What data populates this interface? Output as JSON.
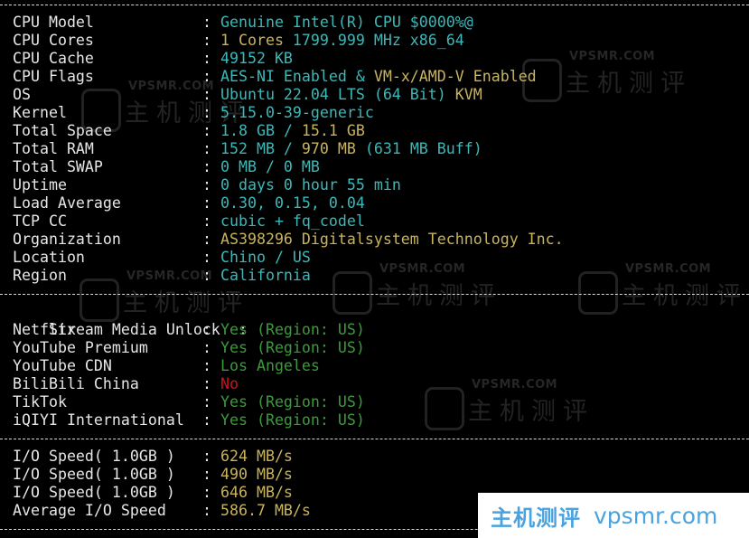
{
  "system_info": [
    {
      "label": "CPU Model",
      "segments": [
        {
          "text": "Genuine Intel(R) CPU $0000%@",
          "color": "cyan"
        }
      ]
    },
    {
      "label": "CPU Cores",
      "segments": [
        {
          "text": "1 Cores",
          "color": "yellow"
        },
        {
          "text": " 1799.999 MHz x86_64",
          "color": "cyan"
        }
      ]
    },
    {
      "label": "CPU Cache",
      "segments": [
        {
          "text": "49152 KB",
          "color": "cyan"
        }
      ]
    },
    {
      "label": "CPU Flags",
      "segments": [
        {
          "text": "AES-NI Enabled & ",
          "color": "cyan"
        },
        {
          "text": "VM-x/AMD-V Enabled",
          "color": "yellow"
        }
      ]
    },
    {
      "label": "OS",
      "segments": [
        {
          "text": "Ubuntu 22.04 LTS (64 Bit) ",
          "color": "cyan"
        },
        {
          "text": "KVM",
          "color": "yellow"
        }
      ]
    },
    {
      "label": "Kernel",
      "segments": [
        {
          "text": "5.15.0-39-generic",
          "color": "cyan"
        }
      ]
    },
    {
      "label": "Total Space",
      "segments": [
        {
          "text": "1.8 GB / ",
          "color": "cyan"
        },
        {
          "text": "15.1 GB",
          "color": "yellow"
        }
      ]
    },
    {
      "label": "Total RAM",
      "segments": [
        {
          "text": "152 MB / ",
          "color": "cyan"
        },
        {
          "text": "970 MB",
          "color": "yellow"
        },
        {
          "text": " (631 MB Buff)",
          "color": "cyan"
        }
      ]
    },
    {
      "label": "Total SWAP",
      "segments": [
        {
          "text": "0 MB / 0 MB",
          "color": "cyan"
        }
      ]
    },
    {
      "label": "Uptime",
      "segments": [
        {
          "text": "0 days 0 hour 55 min",
          "color": "cyan"
        }
      ]
    },
    {
      "label": "Load Average",
      "segments": [
        {
          "text": "0.30, 0.15, 0.04",
          "color": "cyan"
        }
      ]
    },
    {
      "label": "TCP CC",
      "segments": [
        {
          "text": "cubic + fq_codel",
          "color": "cyan"
        }
      ]
    },
    {
      "label": "Organization",
      "segments": [
        {
          "text": "AS398296 Digitalsystem Technology Inc.",
          "color": "yellow"
        }
      ]
    },
    {
      "label": "Location",
      "segments": [
        {
          "text": "Chino / US",
          "color": "cyan"
        }
      ]
    },
    {
      "label": "Region",
      "segments": [
        {
          "text": "California",
          "color": "cyan"
        }
      ]
    }
  ],
  "stream_media": {
    "header": "Stream Media Unlock",
    "items": [
      {
        "label": "Netflix",
        "segments": [
          {
            "text": "Yes (Region: US)",
            "color": "green"
          }
        ]
      },
      {
        "label": "YouTube Premium",
        "segments": [
          {
            "text": "Yes (Region: US)",
            "color": "green"
          }
        ]
      },
      {
        "label": "YouTube CDN",
        "segments": [
          {
            "text": "Los Angeles",
            "color": "green"
          }
        ]
      },
      {
        "label": "BiliBili China",
        "segments": [
          {
            "text": "No",
            "color": "red"
          }
        ]
      },
      {
        "label": "TikTok",
        "segments": [
          {
            "text": "Yes (Region: US)",
            "color": "green"
          }
        ]
      },
      {
        "label": "iQIYI International",
        "segments": [
          {
            "text": "Yes (Region: US)",
            "color": "green"
          }
        ]
      }
    ]
  },
  "io_speed": [
    {
      "label": "I/O Speed( 1.0GB )",
      "segments": [
        {
          "text": "624 MB/s",
          "color": "yellow"
        }
      ]
    },
    {
      "label": "I/O Speed( 1.0GB )",
      "segments": [
        {
          "text": "490 MB/s",
          "color": "yellow"
        }
      ]
    },
    {
      "label": "I/O Speed( 1.0GB )",
      "segments": [
        {
          "text": "646 MB/s",
          "color": "yellow"
        }
      ]
    },
    {
      "label": "Average I/O Speed",
      "segments": [
        {
          "text": "586.7 MB/s",
          "color": "yellow"
        }
      ]
    }
  ],
  "separator_char": ":",
  "watermark": {
    "url": "VPSMR.COM",
    "cn": "主机测评",
    "badge_cn": "主机测评",
    "badge_en": "vpsmr.com"
  },
  "colors": {
    "cyan": "#3bb8b8",
    "yellow": "#c9b45c",
    "green": "#3b9b3b",
    "red": "#c8141e",
    "label": "#e6e6e6",
    "background": "#000000",
    "badge_text": "#4aa3de"
  }
}
